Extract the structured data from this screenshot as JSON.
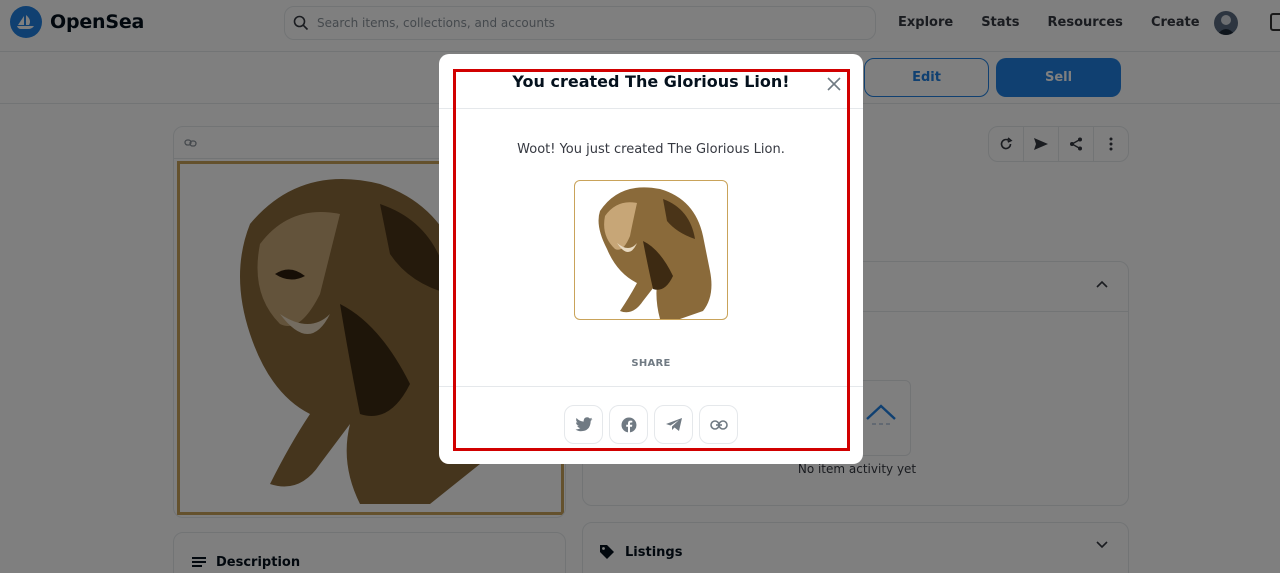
{
  "brand": {
    "name": "OpenSea"
  },
  "search": {
    "placeholder": "Search items, collections, and accounts"
  },
  "nav": {
    "links": [
      "Explore",
      "Stats",
      "Resources",
      "Create"
    ]
  },
  "actions": {
    "edit_label": "Edit",
    "sell_label": "Sell"
  },
  "description": {
    "title": "Description"
  },
  "activity": {
    "empty_text": "No item activity yet"
  },
  "listings": {
    "title": "Listings"
  },
  "modal": {
    "title": "You created The Glorious Lion!",
    "message": "Woot! You just created The Glorious Lion.",
    "share_label": "SHARE",
    "share_buttons": [
      "twitter-icon",
      "facebook-icon",
      "telegram-icon",
      "link-icon"
    ]
  },
  "colors": {
    "accent": "#2081e2",
    "highlight": "#d10000",
    "frame": "#c9a35a"
  }
}
